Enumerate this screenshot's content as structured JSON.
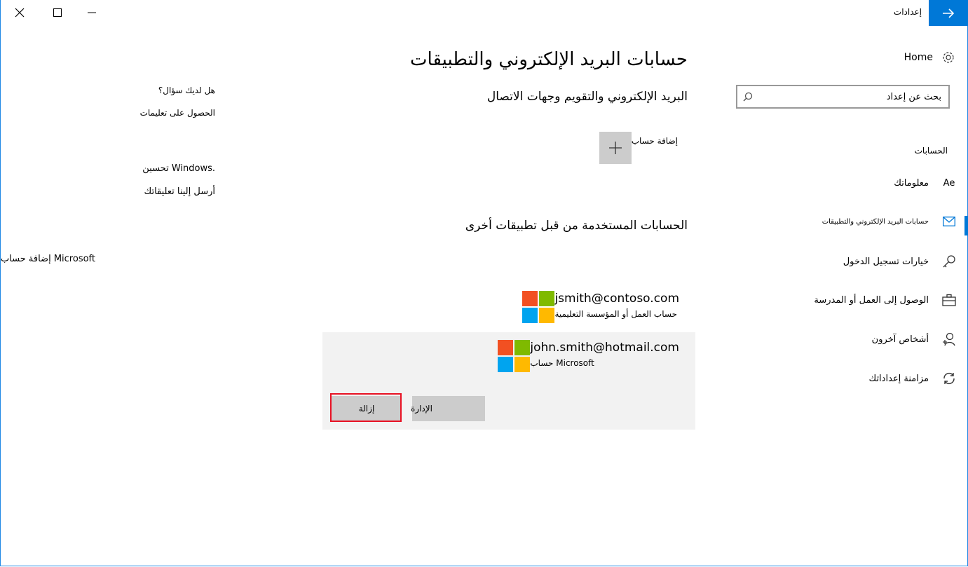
{
  "window": {
    "title": "إعدادات",
    "controls": {
      "minimize": "—",
      "maximize": "☐",
      "close": "✕"
    }
  },
  "sidebar": {
    "home_label": "Home",
    "search_placeholder": "بحث عن إعداد",
    "heading": "الحسابات",
    "items": [
      {
        "label": "معلوماتك",
        "icon": "Ae"
      },
      {
        "label": "حسابات البريد الإلكتروني والتطبيقات",
        "icon": "mail-icon",
        "active": true
      },
      {
        "label": "خيارات تسجيل الدخول",
        "icon": "key-icon"
      },
      {
        "label": "الوصول إلى العمل أو المدرسة",
        "icon": "briefcase-icon"
      },
      {
        "label": "أشخاص آخرون",
        "icon": "person-add-icon"
      },
      {
        "label": "مزامنة إعداداتك",
        "icon": "sync-icon"
      }
    ]
  },
  "main": {
    "title": "حسابات البريد الإلكتروني والتطبيقات",
    "section1": "البريد الإلكتروني والتقويم وجهات الاتصال",
    "add_account": "إضافة حساب",
    "section2": "الحسابات المستخدمة من قبل تطبيقات أخرى",
    "accounts": [
      {
        "email": "jsmith@contoso.com",
        "type": "حساب العمل أو المؤسسة التعليمية"
      },
      {
        "email": "john.smith@hotmail.com",
        "type": "حساب Microsoft"
      }
    ],
    "buttons": {
      "manage": "الإدارة",
      "remove": "إزالة"
    }
  },
  "help": {
    "question": "هل لديك سؤال؟",
    "get_help": "الحصول على تعليمات",
    "improve": "تحسين Windows.",
    "feedback": "أرسل إلينا تعليقاتك",
    "add_ms_account": "إضافة حساب Microsoft"
  },
  "colors": {
    "accent": "#0078d7",
    "ms_red": "#f25022",
    "ms_green": "#7fba00",
    "ms_blue": "#00a4ef",
    "ms_yellow": "#ffb900",
    "highlight": "#e81123"
  }
}
